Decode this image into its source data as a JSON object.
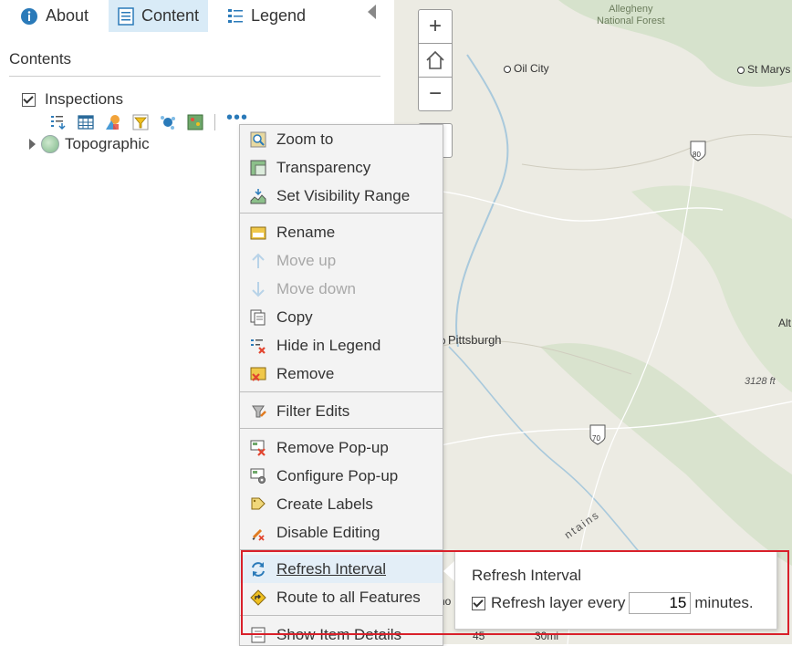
{
  "tabs": [
    {
      "label": "About"
    },
    {
      "label": "Content"
    },
    {
      "label": "Legend"
    }
  ],
  "contents": {
    "title": "Contents",
    "layers": [
      {
        "label": "Inspections",
        "checked": true
      },
      {
        "label": "Topographic"
      }
    ]
  },
  "context_menu": {
    "items": [
      {
        "label": "Zoom to",
        "icon": "zoom-to-icon"
      },
      {
        "label": "Transparency",
        "icon": "transparency-icon"
      },
      {
        "label": "Set Visibility Range",
        "icon": "visibility-range-icon"
      },
      {
        "label": "Rename",
        "icon": "rename-icon"
      },
      {
        "label": "Move up",
        "icon": "arrow-up-icon",
        "disabled": true
      },
      {
        "label": "Move down",
        "icon": "arrow-down-icon",
        "disabled": true
      },
      {
        "label": "Copy",
        "icon": "copy-icon"
      },
      {
        "label": "Hide in Legend",
        "icon": "hide-legend-icon"
      },
      {
        "label": "Remove",
        "icon": "remove-icon"
      },
      {
        "label": "Filter Edits",
        "icon": "filter-edits-icon"
      },
      {
        "label": "Remove Pop-up",
        "icon": "remove-popup-icon"
      },
      {
        "label": "Configure Pop-up",
        "icon": "configure-popup-icon"
      },
      {
        "label": "Create Labels",
        "icon": "create-labels-icon"
      },
      {
        "label": "Disable Editing",
        "icon": "disable-editing-icon"
      },
      {
        "label": "Refresh Interval",
        "icon": "refresh-icon",
        "active": true
      },
      {
        "label": "Route to all Features",
        "icon": "route-icon"
      },
      {
        "label": "Show Item Details",
        "icon": "item-details-icon"
      }
    ]
  },
  "refresh_interval": {
    "title": "Refresh Interval",
    "checkbox_label": "Refresh layer every",
    "checked": true,
    "value": "15",
    "unit": "minutes."
  },
  "map": {
    "labels": {
      "forest": "Allegheny\nNational Forest",
      "oil_city": "Oil City",
      "st_marys": "St Marys",
      "pittsburgh": "Pittsburgh",
      "alt": "Alt",
      "elevation": "3128 ft",
      "mountains": "ntains",
      "interstate_80": "80",
      "interstate_70": "70",
      "scale_km": "45",
      "scale_mi": "30mi",
      "partial_left": "no"
    }
  },
  "colors": {
    "tab_active_bg": "#d9ebf7",
    "highlight": "#d9202a",
    "menu_bg": "#f3f3f3",
    "link_blue": "#2a7ab9"
  }
}
